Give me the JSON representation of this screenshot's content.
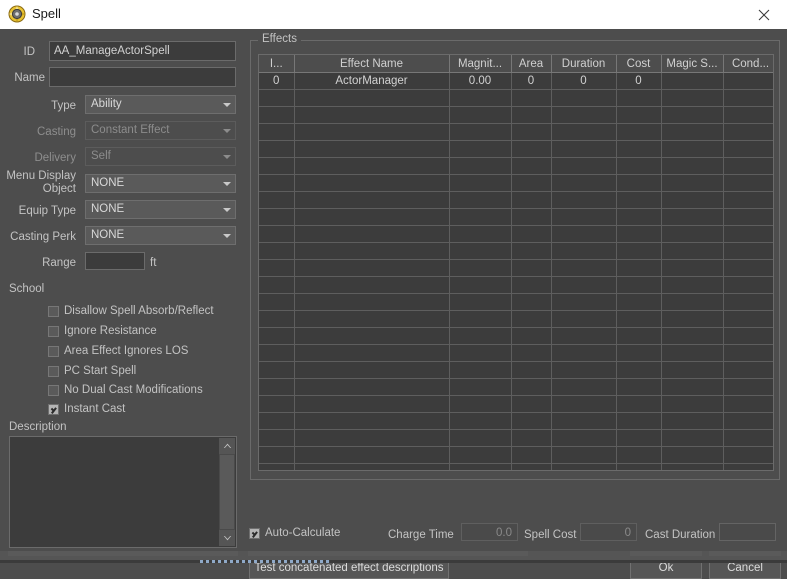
{
  "window": {
    "title": "Spell",
    "icon": "creation-kit-spell-icon",
    "close_label": "✕"
  },
  "form": {
    "id": {
      "label": "ID",
      "value": "AA_ManageActorSpell"
    },
    "name": {
      "label": "Name",
      "value": ""
    },
    "type": {
      "label": "Type",
      "value": "Ability",
      "enabled": true
    },
    "casting": {
      "label": "Casting",
      "value": "Constant Effect",
      "enabled": false
    },
    "delivery": {
      "label": "Delivery",
      "value": "Self",
      "enabled": false
    },
    "menu_display_object": {
      "label": "Menu Display Object",
      "label_line1": "Menu Display",
      "label_line2": "Object",
      "value": "NONE",
      "enabled": true
    },
    "equip_type": {
      "label": "Equip Type",
      "value": "NONE",
      "enabled": true
    },
    "casting_perk": {
      "label": "Casting Perk",
      "value": "NONE",
      "enabled": true
    },
    "range": {
      "label": "Range",
      "value": "",
      "unit": "ft"
    },
    "school": {
      "label": "School"
    },
    "description": {
      "label": "Description",
      "value": ""
    }
  },
  "flags": [
    {
      "label": "Disallow Spell Absorb/Reflect",
      "checked": false
    },
    {
      "label": "Ignore Resistance",
      "checked": false
    },
    {
      "label": "Area Effect Ignores LOS",
      "checked": false
    },
    {
      "label": "PC Start Spell",
      "checked": false
    },
    {
      "label": "No Dual Cast Modifications",
      "checked": false
    },
    {
      "label": "Instant Cast",
      "checked": true
    }
  ],
  "effects": {
    "group_label": "Effects",
    "columns": [
      "I...",
      "Effect Name",
      "Magnit...",
      "Area",
      "Duration",
      "Cost",
      "Magic S...",
      "Cond...",
      ""
    ],
    "rows": [
      {
        "index": "0",
        "effect_name": "ActorManager",
        "magnitude": "0.00",
        "area": "0",
        "duration": "0",
        "cost": "0",
        "magic_skill": "",
        "conditions": "",
        "extra": ""
      }
    ],
    "empty_row_count": 23
  },
  "footer": {
    "auto_calculate": {
      "label": "Auto-Calculate",
      "checked": true
    },
    "charge_time": {
      "label": "Charge Time",
      "value": "0.0"
    },
    "spell_cost": {
      "label": "Spell Cost",
      "value": "0"
    },
    "cast_duration": {
      "label": "Cast Duration",
      "value": ""
    },
    "test_button": "Test concatenated effect descriptions",
    "ok_button": "Ok",
    "cancel_button": "Cancel"
  },
  "colors": {
    "titlebar_bg": "#ffffff",
    "dialog_bg": "#4d4d4d",
    "field_bg": "#3c3c3c",
    "combo_bg": "#5a5a5a",
    "border": "#6b6b6b",
    "text": "#c3c3c3",
    "text_disabled": "#8c8c8c"
  }
}
